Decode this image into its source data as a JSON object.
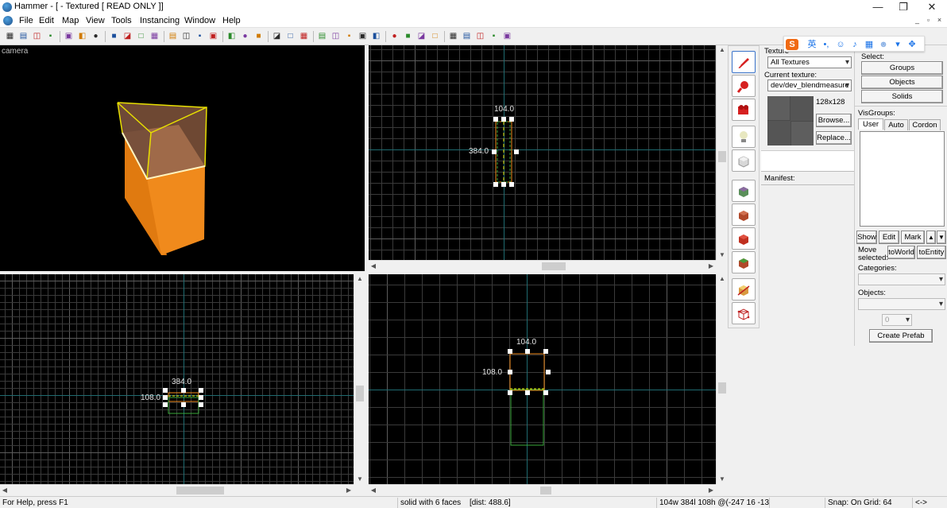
{
  "window": {
    "title": "Hammer - [ - Textured [ READ ONLY ]]",
    "controls": {
      "minimize": "—",
      "restore": "❐",
      "close": "✕"
    }
  },
  "menu": {
    "items": [
      "File",
      "Edit",
      "Map",
      "View",
      "Tools",
      "Instancing",
      "Window",
      "Help"
    ],
    "mdi_controls": {
      "minimize": "_",
      "restore": "▫",
      "close": "×"
    }
  },
  "toolbar": {
    "buttons": [
      "grid",
      "grid-3d",
      "snap",
      "dots",
      "group",
      "ungroup",
      "hide",
      "cube-sel",
      "carve",
      "ignore-groups",
      "v1",
      "v2",
      "v3",
      "v4",
      "cut",
      "copy",
      "paste",
      "rect",
      "red-x",
      "r",
      "select",
      "toggle",
      "texture",
      "entity",
      "a",
      "b",
      "c",
      "d",
      "e",
      "f",
      "g",
      "cm",
      "h",
      "i",
      "j"
    ]
  },
  "viewports": {
    "camera": {
      "label": "camera"
    },
    "top": {
      "width_label": "104.0",
      "height_label": "384.0"
    },
    "front": {
      "width_label": "384.0",
      "height_label": "108.0"
    },
    "side": {
      "width_label": "104.0",
      "height_label": "108.0"
    }
  },
  "texture_panel": {
    "title": "Texture",
    "filter": "All Textures",
    "current_label": "Current texture:",
    "current_value": "dev/dev_blendmeasure",
    "size": "128x128",
    "browse": "Browse...",
    "replace": "Replace...",
    "manifest": "Manifest:"
  },
  "select_panel": {
    "title": "Select:",
    "buttons": [
      "Groups",
      "Objects",
      "Solids"
    ],
    "visgroups_label": "VisGroups:",
    "tabs": [
      "User",
      "Auto",
      "Cordon"
    ],
    "show": "Show",
    "edit": "Edit",
    "mark": "Mark",
    "up": "▲",
    "down": "▼",
    "move_selected": [
      "Move",
      "selected:"
    ],
    "to_world": "toWorld",
    "to_entity": "toEntity",
    "categories_label": "Categories:",
    "objects_label": "Objects:",
    "count": "0",
    "create_prefab": "Create Prefab"
  },
  "ime": {
    "logo": "S",
    "lang": "英",
    "icons": [
      "punctuation-icon",
      "emoji-icon",
      "mic-icon",
      "keyboard-icon",
      "user-icon",
      "skin-icon",
      "apps-icon"
    ]
  },
  "statusbar": {
    "help": "For Help, press F1",
    "selection": "solid with 6 faces",
    "dist": "[dist: 488.6]",
    "size": "104w 384l 108h @(-247 16 -13",
    "snap": "Snap: On Grid: 64",
    "extra": "<->"
  },
  "colors": {
    "grid_minor": "#3a3a3a",
    "grid_major": "#5c5c5c",
    "axis_teal": "#1f6b70",
    "axis_red": "#6b2a1c",
    "brush_orange": "#f08a1c",
    "brush_yellow": "#e8e000",
    "selection_green": "#3aa83a"
  }
}
